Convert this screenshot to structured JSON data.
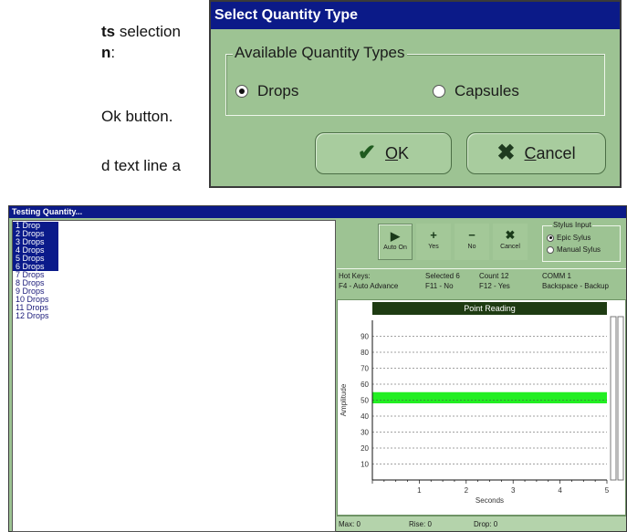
{
  "document": {
    "line1_bold": "ts",
    "line1_rest": " selection",
    "line2_bold": "n",
    "line2_rest": ":",
    "line3": "Ok button.",
    "line4": "d text line a"
  },
  "select_dialog": {
    "title": "Select Quantity Type",
    "group_label": "Available Quantity Types",
    "options": [
      {
        "label": "Drops",
        "selected": true
      },
      {
        "label": "Capsules",
        "selected": false
      }
    ],
    "ok_label_accel": "O",
    "ok_label_rest": "K",
    "cancel_label_accel": "C",
    "cancel_label_rest": "ancel",
    "ok_icon": "checkmark-icon",
    "cancel_icon": "x-icon",
    "ok_icon_color": "#1f5a1f",
    "cancel_icon_color": "#1f3a1f"
  },
  "testing_window": {
    "title": "Testing Quantity...",
    "list_items": [
      {
        "label": "1 Drop",
        "selected": true
      },
      {
        "label": "2 Drops",
        "selected": true
      },
      {
        "label": "3 Drops",
        "selected": true
      },
      {
        "label": "4 Drops",
        "selected": true
      },
      {
        "label": "5 Drops",
        "selected": true
      },
      {
        "label": "6 Drops",
        "selected": true
      },
      {
        "label": "7 Drops",
        "selected": false
      },
      {
        "label": "8 Drops",
        "selected": false
      },
      {
        "label": "9 Drops",
        "selected": false
      },
      {
        "label": "10 Drops",
        "selected": false
      },
      {
        "label": "11 Drops",
        "selected": false
      },
      {
        "label": "12 Drops",
        "selected": false
      }
    ],
    "toolbar": {
      "auto_on": "Auto On",
      "yes": "Yes",
      "no": "No",
      "cancel": "Cancel"
    },
    "stylus": {
      "group_label": "Stylus Input",
      "options": [
        {
          "label": "Epic Sylus",
          "selected": true
        },
        {
          "label": "Manual Sylus",
          "selected": false
        }
      ]
    },
    "hotkeys": {
      "label": "Hot Keys:",
      "f4": "F4 - Auto Advance",
      "selected": "Selected 6",
      "f11": "F11 - No",
      "count": "Count 12",
      "f12": "F12 - Yes",
      "comm": "COMM 1",
      "backspace": "Backspace - Backup"
    },
    "status": {
      "max": "Max: 0",
      "rise": "Rise: 0",
      "drop": "Drop: 0"
    },
    "selection_color": "#0a1a8a",
    "band_color": "#22ee22"
  },
  "chart_data": {
    "type": "line",
    "title": "Point Reading",
    "xlabel": "Seconds",
    "ylabel": "Amplitude",
    "xlim": [
      0,
      5
    ],
    "ylim": [
      0,
      100
    ],
    "xticks": [
      "1",
      "2",
      "3",
      "4",
      "5"
    ],
    "yticks": [
      "10",
      "20",
      "30",
      "40",
      "50",
      "60",
      "70",
      "80",
      "90"
    ],
    "grid": true,
    "band": {
      "y_low": 48,
      "y_high": 55
    },
    "series": []
  }
}
